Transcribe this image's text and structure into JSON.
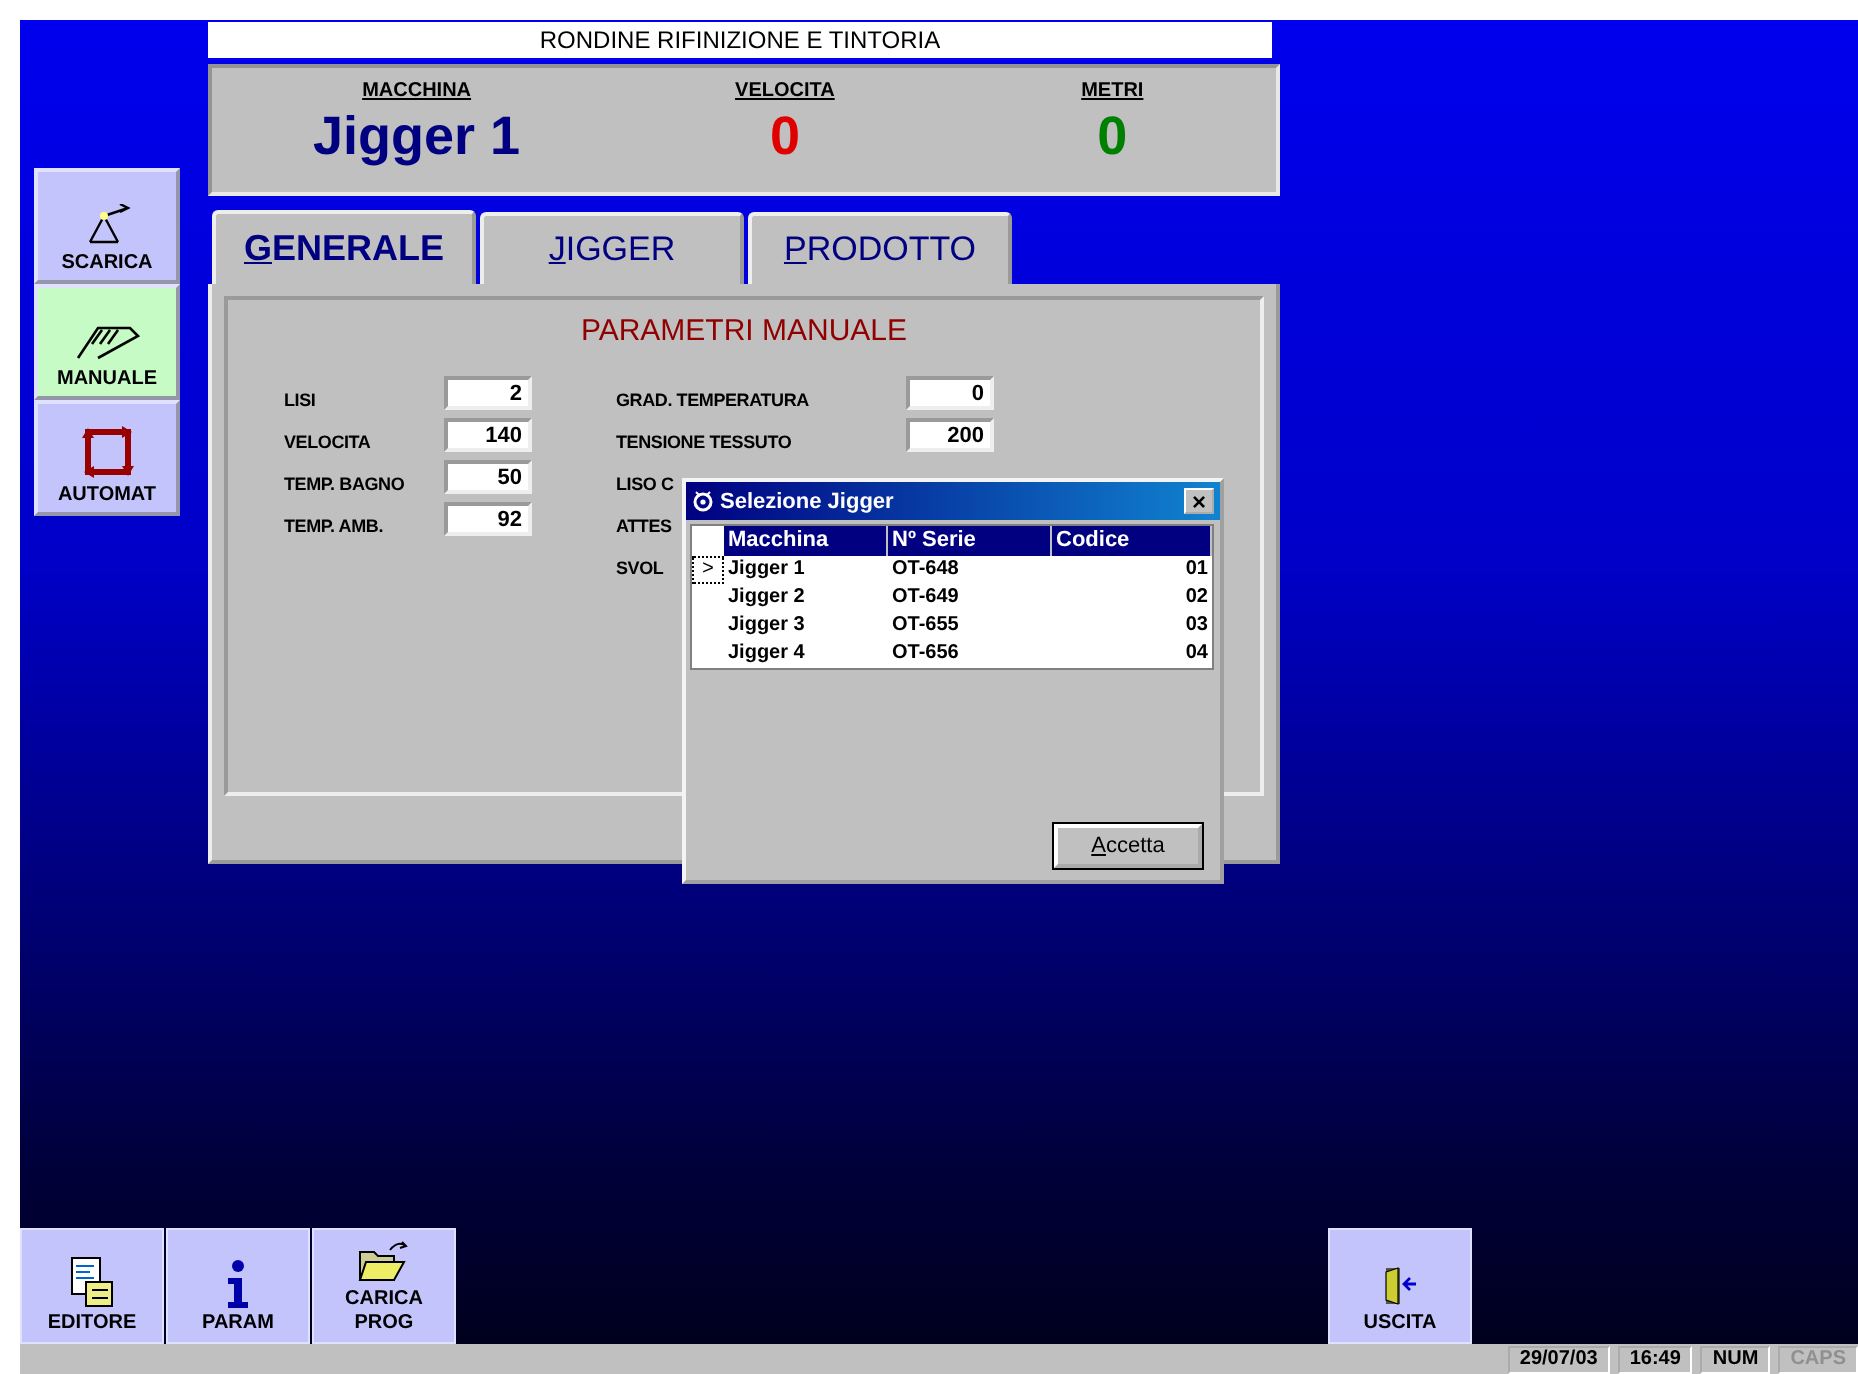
{
  "title": "RONDINE RIFINIZIONE E TINTORIA",
  "header": [
    {
      "label": "MACCHINA",
      "value": "Jigger 1",
      "kind": "name"
    },
    {
      "label": "VELOCITA",
      "value": "0",
      "kind": "speed"
    },
    {
      "label": "METRI",
      "value": "0",
      "kind": "meters"
    }
  ],
  "side_nav": [
    {
      "label": "SCARICA",
      "kind": "scarica",
      "selected": false
    },
    {
      "label": "MANUALE",
      "kind": "manuale",
      "selected": true
    },
    {
      "label": "AUTOMAT",
      "kind": "automat",
      "selected": false
    }
  ],
  "tabs": [
    {
      "label": "GENERALE",
      "selected": true
    },
    {
      "label": "JIGGER",
      "selected": false
    },
    {
      "label": "PRODOTTO",
      "selected": false
    }
  ],
  "panel_title": "PARAMETRI MANUALE",
  "params_left": [
    {
      "label": "LISI",
      "value": "2"
    },
    {
      "label": "VELOCITA",
      "value": "140"
    },
    {
      "label": "TEMP. BAGNO",
      "value": "50"
    },
    {
      "label": "TEMP. AMB.",
      "value": "92"
    }
  ],
  "params_right": [
    {
      "label": "GRAD. TEMPERATURA",
      "value": "0"
    },
    {
      "label": "TENSIONE TESSUTO",
      "value": "200"
    },
    {
      "label": "LISO C"
    },
    {
      "label": "ATTES"
    },
    {
      "label": "SVOL"
    }
  ],
  "dialog": {
    "title": "Selezione Jigger",
    "close": "×",
    "columns": [
      "Macchina",
      "Nº Serie",
      "Codice"
    ],
    "rows": [
      {
        "cells": [
          "Jigger 1",
          "OT-648",
          "01"
        ],
        "selected": true
      },
      {
        "cells": [
          "Jigger 2",
          "OT-649",
          "02"
        ],
        "selected": false
      },
      {
        "cells": [
          "Jigger 3",
          "OT-655",
          "03"
        ],
        "selected": false
      },
      {
        "cells": [
          "Jigger 4",
          "OT-656",
          "04"
        ],
        "selected": false
      }
    ],
    "row_marker": ">",
    "button": "Accetta"
  },
  "bottom_left": [
    {
      "label": "EDITORE",
      "kind": "editor"
    },
    {
      "label": "PARAM",
      "kind": "info"
    },
    {
      "label": "CARICA PROG",
      "kind": "folder"
    }
  ],
  "bottom_right": [
    {
      "label": "USCITA",
      "kind": "exit"
    }
  ],
  "status_bar": [
    {
      "text": "29/07/03",
      "disabled": false
    },
    {
      "text": "16:49",
      "disabled": false
    },
    {
      "text": "NUM",
      "disabled": false
    },
    {
      "text": "CAPS",
      "disabled": true
    }
  ]
}
